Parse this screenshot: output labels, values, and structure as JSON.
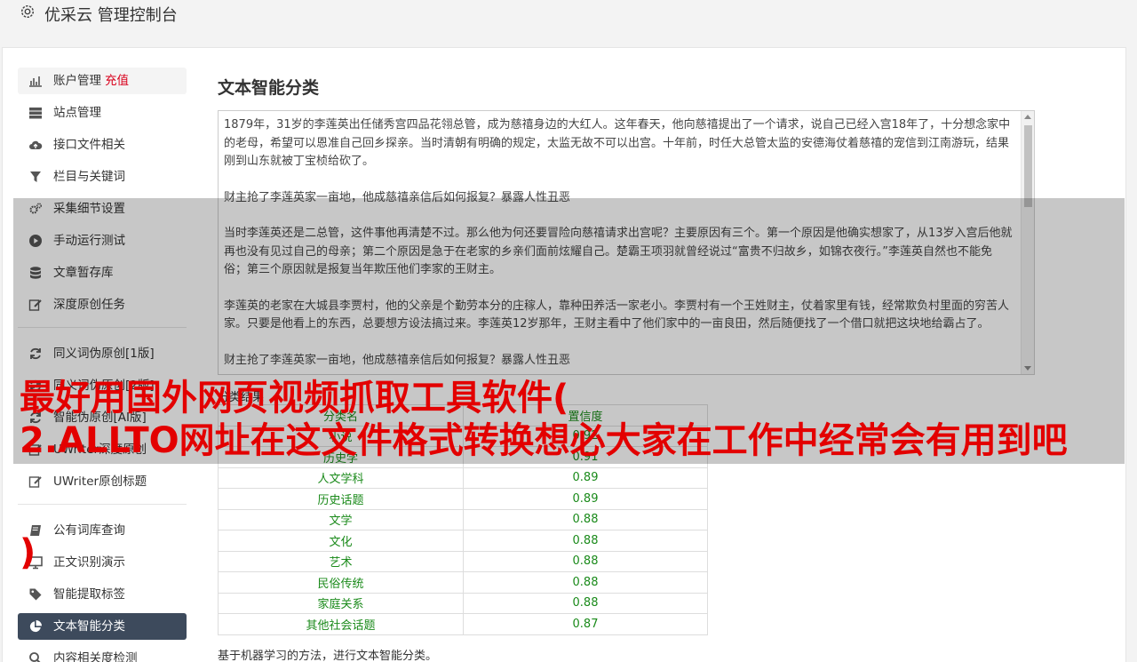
{
  "header": {
    "title": "优采云 管理控制台"
  },
  "sidebar": {
    "group1": [
      {
        "label": "账户管理",
        "tag": "充值",
        "icon": "bar-chart-icon"
      },
      {
        "label": "站点管理",
        "icon": "server-icon"
      },
      {
        "label": "接口文件相关",
        "icon": "cloud-upload-icon"
      },
      {
        "label": "栏目与关键词",
        "icon": "filter-icon"
      },
      {
        "label": "采集细节设置",
        "icon": "gears-icon"
      },
      {
        "label": "手动运行测试",
        "icon": "play-circle-icon"
      },
      {
        "label": "文章暂存库",
        "icon": "database-icon"
      },
      {
        "label": "深度原创任务",
        "icon": "edit-icon"
      }
    ],
    "group2": [
      {
        "label": "同义词伪原创[1版]",
        "icon": "refresh-icon"
      },
      {
        "label": "同义词伪原创[2版]",
        "icon": "refresh-icon"
      },
      {
        "label": "智能伪原创[AI版]",
        "icon": "refresh-icon"
      },
      {
        "label": "UWriter深度原创",
        "icon": "edit-icon"
      },
      {
        "label": "UWriter原创标题",
        "icon": "edit-icon"
      }
    ],
    "group3": [
      {
        "label": "公有词库查询",
        "icon": "book-icon"
      },
      {
        "label": "正文识别演示",
        "icon": "monitor-icon"
      },
      {
        "label": "智能提取标签",
        "icon": "tag-icon"
      },
      {
        "label": "文本智能分类",
        "icon": "pie-chart-icon"
      },
      {
        "label": "内容相关度检测",
        "icon": "search-icon"
      }
    ]
  },
  "main": {
    "title": "文本智能分类",
    "text_paragraphs": [
      "1879年，31岁的李莲英出任储秀宫四品花翎总管，成为慈禧身边的大红人。这年春天，他向慈禧提出了一个请求，说自己已经入宫18年了，十分想念家中的老母，希望可以恩准自己回乡探亲。当时清朝有明确的规定，太监无故不可以出宫。十年前，时任大总管太监的安德海仗着慈禧的宠信到江南游玩，结果刚到山东就被丁宝桢给砍了。",
      "财主抢了李莲英家一亩地，他成慈禧亲信后如何报复？暴露人性丑恶",
      "当时李莲英还是二总管，这件事他再清楚不过。那么他为何还要冒险向慈禧请求出宫呢？主要原因有三个。第一个原因是他确实想家了，从13岁入宫后他就再也没有见过自己的母亲；第二个原因是急于在老家的乡亲们面前炫耀自己。楚霸王项羽就曾经说过“富贵不归故乡，如锦衣夜行。”李莲英自然也不能免俗；第三个原因就是报复当年欺压他们李家的王财主。",
      "李莲英的老家在大城县李贾村，他的父亲是个勤劳本分的庄稼人，靠种田养活一家老小。李贾村有一个王姓财主，仗着家里有钱，经常欺负村里面的穷苦人家。只要是他看上的东西，总要想方设法搞过来。李莲英12岁那年，王财主看中了他们家中的一亩良田，然后随便找了一个借口就把这块地给霸占了。",
      "财主抢了李莲英家一亩地，他成慈禧亲信后如何报复？暴露人性丑恶"
    ],
    "result_caption": "分类结果",
    "table": {
      "headers": [
        "分类名",
        "置信度"
      ],
      "rows": [
        [
          "小说",
          "0.92"
        ],
        [
          "历史学",
          "0.91"
        ],
        [
          "人文学科",
          "0.89"
        ],
        [
          "历史话题",
          "0.89"
        ],
        [
          "文学",
          "0.88"
        ],
        [
          "文化",
          "0.88"
        ],
        [
          "艺术",
          "0.88"
        ],
        [
          "民俗传统",
          "0.88"
        ],
        [
          "家庭关系",
          "0.88"
        ],
        [
          "其他社会话题",
          "0.87"
        ]
      ]
    },
    "footnote": "基于机器学习的方法，进行文本智能分类。"
  },
  "overlay": {
    "line1": "最好用国外网页视频抓取工具软件(",
    "line2": "2.ALLTO网址在这文件格式转换想必大家在工作中经常会有用到吧",
    "line3": ")"
  },
  "colors": {
    "active_nav": "#3d4a5c",
    "result_green": "#1a8a1a",
    "tag_red": "#d9001b",
    "overlay_red": "#e30000"
  }
}
